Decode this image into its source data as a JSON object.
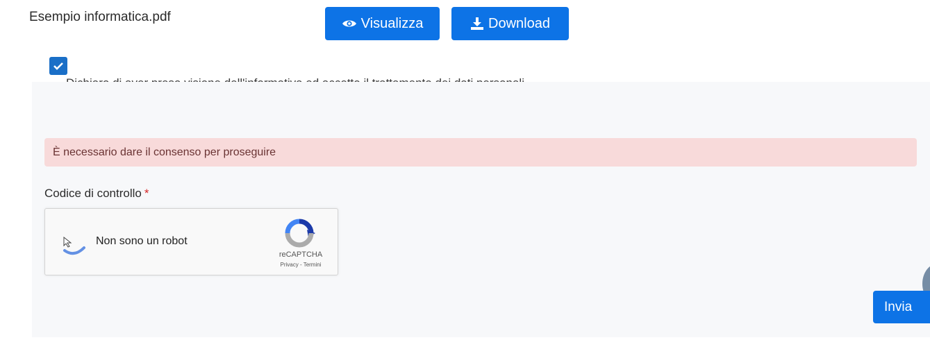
{
  "file": {
    "name": "Esempio informatica.pdf"
  },
  "actions": {
    "view_label": "Visualizza",
    "view_icon": "eye-icon",
    "download_label": "Download",
    "download_icon": "download-icon"
  },
  "consent": {
    "checked": true,
    "text": "Dichiaro di aver preso visione dell'informativa ed accetto il trattamento dei dati personali"
  },
  "alert": {
    "message": "È necessario dare il consenso per proseguire"
  },
  "captcha": {
    "label": "Codice di controllo",
    "required_mark": "*",
    "checkbox_label": "Non sono un robot",
    "brand": "reCAPTCHA",
    "links": "Privacy - Termini"
  },
  "submit": {
    "label": "Invia"
  },
  "colors": {
    "primary": "#0d73e6",
    "alert_bg": "#f8dada",
    "required": "#d62828"
  }
}
